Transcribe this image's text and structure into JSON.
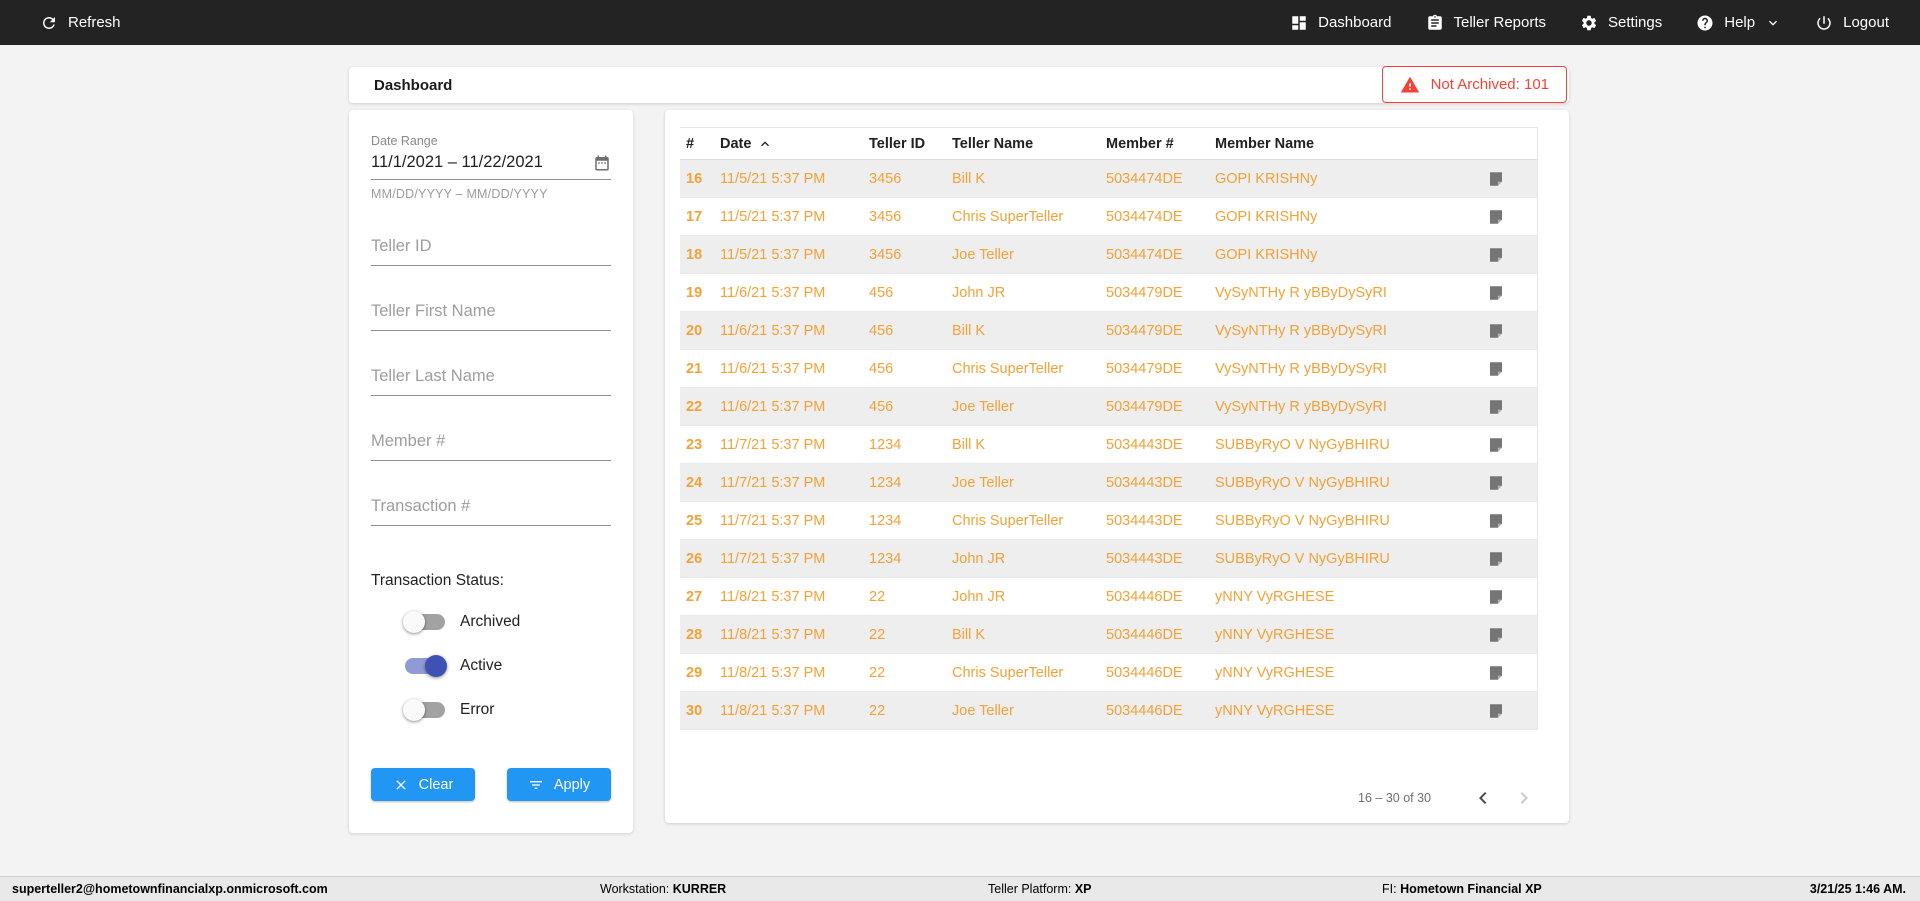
{
  "navbar": {
    "refresh_label": "Refresh",
    "items": [
      {
        "label": "Dashboard",
        "icon": "dashboard-icon"
      },
      {
        "label": "Teller Reports",
        "icon": "teller-reports-icon"
      },
      {
        "label": "Settings",
        "icon": "settings-icon"
      },
      {
        "label": "Help",
        "icon": "help-icon"
      },
      {
        "label": "Logout",
        "icon": "logout-icon"
      }
    ]
  },
  "header": {
    "title": "Dashboard",
    "alert_badge": "Not Archived: 101"
  },
  "filters": {
    "date_range": {
      "label": "Date Range",
      "value": "11/1/2021 – 11/22/2021",
      "hint": "MM/DD/YYYY – MM/DD/YYYY"
    },
    "inputs": [
      {
        "placeholder": "Teller ID"
      },
      {
        "placeholder": "Teller First Name"
      },
      {
        "placeholder": "Teller Last Name"
      },
      {
        "placeholder": "Member #"
      },
      {
        "placeholder": "Transaction #"
      }
    ],
    "status": {
      "label": "Transaction Status:",
      "toggles": [
        {
          "label": "Archived",
          "on": false
        },
        {
          "label": "Active",
          "on": true
        },
        {
          "label": "Error",
          "on": false
        }
      ]
    },
    "clear_label": "Clear",
    "apply_label": "Apply"
  },
  "table": {
    "columns": [
      "#",
      "Date",
      "Teller ID",
      "Teller Name",
      "Member #",
      "Member Name"
    ],
    "sort_column": "Date",
    "sort_direction": "ascending",
    "rows": [
      {
        "num": "16",
        "date": "11/5/21 5:37 PM",
        "teller_id": "3456",
        "teller_name": "Bill K",
        "member_num": "5034474DE",
        "member_name": "GOPI KRISHNy"
      },
      {
        "num": "17",
        "date": "11/5/21 5:37 PM",
        "teller_id": "3456",
        "teller_name": "Chris SuperTeller",
        "member_num": "5034474DE",
        "member_name": "GOPI KRISHNy"
      },
      {
        "num": "18",
        "date": "11/5/21 5:37 PM",
        "teller_id": "3456",
        "teller_name": "Joe Teller",
        "member_num": "5034474DE",
        "member_name": "GOPI KRISHNy"
      },
      {
        "num": "19",
        "date": "11/6/21 5:37 PM",
        "teller_id": "456",
        "teller_name": "John JR",
        "member_num": "5034479DE",
        "member_name": "VySyNTHy R yBByDySyRI"
      },
      {
        "num": "20",
        "date": "11/6/21 5:37 PM",
        "teller_id": "456",
        "teller_name": "Bill K",
        "member_num": "5034479DE",
        "member_name": "VySyNTHy R yBByDySyRI"
      },
      {
        "num": "21",
        "date": "11/6/21 5:37 PM",
        "teller_id": "456",
        "teller_name": "Chris SuperTeller",
        "member_num": "5034479DE",
        "member_name": "VySyNTHy R yBByDySyRI"
      },
      {
        "num": "22",
        "date": "11/6/21 5:37 PM",
        "teller_id": "456",
        "teller_name": "Joe Teller",
        "member_num": "5034479DE",
        "member_name": "VySyNTHy R yBByDySyRI"
      },
      {
        "num": "23",
        "date": "11/7/21 5:37 PM",
        "teller_id": "1234",
        "teller_name": "Bill K",
        "member_num": "5034443DE",
        "member_name": "SUBByRyO V NyGyBHIRU"
      },
      {
        "num": "24",
        "date": "11/7/21 5:37 PM",
        "teller_id": "1234",
        "teller_name": "Joe Teller",
        "member_num": "5034443DE",
        "member_name": "SUBByRyO V NyGyBHIRU"
      },
      {
        "num": "25",
        "date": "11/7/21 5:37 PM",
        "teller_id": "1234",
        "teller_name": "Chris SuperTeller",
        "member_num": "5034443DE",
        "member_name": "SUBByRyO V NyGyBHIRU"
      },
      {
        "num": "26",
        "date": "11/7/21 5:37 PM",
        "teller_id": "1234",
        "teller_name": "John JR",
        "member_num": "5034443DE",
        "member_name": "SUBByRyO V NyGyBHIRU"
      },
      {
        "num": "27",
        "date": "11/8/21 5:37 PM",
        "teller_id": "22",
        "teller_name": "John JR",
        "member_num": "5034446DE",
        "member_name": "yNNY VyRGHESE"
      },
      {
        "num": "28",
        "date": "11/8/21 5:37 PM",
        "teller_id": "22",
        "teller_name": "Bill K",
        "member_num": "5034446DE",
        "member_name": "yNNY VyRGHESE"
      },
      {
        "num": "29",
        "date": "11/8/21 5:37 PM",
        "teller_id": "22",
        "teller_name": "Chris SuperTeller",
        "member_num": "5034446DE",
        "member_name": "yNNY VyRGHESE"
      },
      {
        "num": "30",
        "date": "11/8/21 5:37 PM",
        "teller_id": "22",
        "teller_name": "Joe Teller",
        "member_num": "5034446DE",
        "member_name": "yNNY VyRGHESE"
      }
    ],
    "pagination": {
      "range": "16 – 30 of 30"
    }
  },
  "footer": {
    "user": "superteller2@hometownfinancialxp.onmicrosoft.com",
    "workstation_label": "Workstation:",
    "workstation": "KURRER",
    "platform_label": "Teller Platform:",
    "platform": "XP",
    "fi_label": "FI:",
    "fi": "Hometown Financial XP",
    "datetime": "3/21/25 1:46 AM."
  },
  "colors": {
    "navbar_bg": "#232323",
    "accent_blue": "#2196F3",
    "alert_red": "#F44336",
    "row_orange": "#F4A136",
    "toggle_on": "#3F51B5",
    "stripe_gray": "#EEEEEE"
  }
}
